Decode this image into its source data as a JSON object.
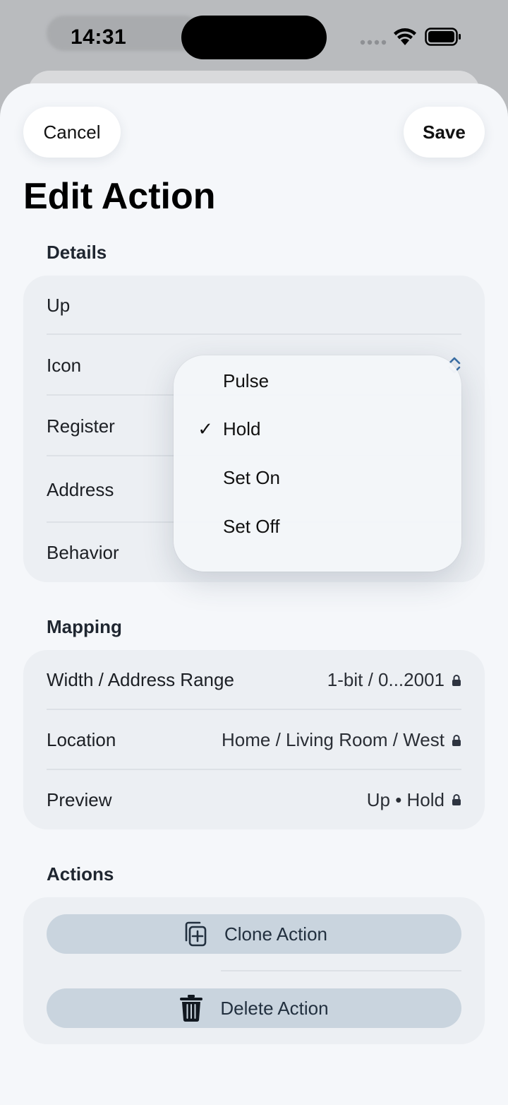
{
  "status_bar": {
    "time": "14:31"
  },
  "nav": {
    "cancel_label": "Cancel",
    "save_label": "Save"
  },
  "title": "Edit Action",
  "details": {
    "header": "Details",
    "name_value": "Up",
    "rows": [
      {
        "label": "Icon"
      },
      {
        "label": "Register"
      },
      {
        "label": "Address"
      },
      {
        "label": "Behavior"
      }
    ]
  },
  "behavior_menu": {
    "selected": "Hold",
    "options": [
      "Pulse",
      "Hold",
      "Set On",
      "Set Off"
    ],
    "check_glyph": "✓"
  },
  "mapping": {
    "header": "Mapping",
    "rows": [
      {
        "label": "Width / Address Range",
        "value": "1-bit / 0...2001"
      },
      {
        "label": "Location",
        "value": "Home / Living Room / West"
      },
      {
        "label": "Preview",
        "value": "Up • Hold"
      }
    ]
  },
  "actions": {
    "header": "Actions",
    "clone_label": "Clone Action",
    "delete_label": "Delete Action"
  },
  "icons": {
    "lock": "lock-icon",
    "clone": "clone-plus-icon",
    "delete": "trash-icon",
    "chevron": "chevron-up-down-icon"
  },
  "colors": {
    "sheet_bg": "#f5f7fa",
    "group_bg": "#eceff3",
    "action_button_bg": "#c9d4de",
    "text_primary": "#000000"
  }
}
